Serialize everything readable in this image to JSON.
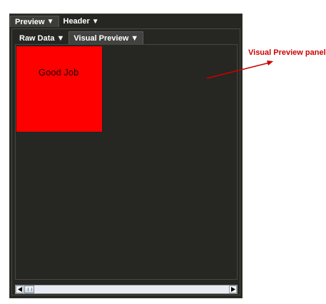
{
  "outer_tabs": [
    {
      "label": "Preview",
      "chevron": "▼",
      "selected": true
    },
    {
      "label": "Header",
      "chevron": "▼",
      "selected": false
    }
  ],
  "inner_tabs": [
    {
      "label": "Raw Data",
      "chevron": "▼",
      "selected": false
    },
    {
      "label": "Visual Preview",
      "chevron": "▼",
      "selected": true
    }
  ],
  "preview": {
    "box_text": "Good Job",
    "box_color": "#ff0000"
  },
  "annotation": {
    "text": "Visual Preview panel",
    "color": "#cc0000"
  },
  "icons": {
    "scroll_left": "scroll-left-arrow-icon",
    "scroll_right": "scroll-right-arrow-icon",
    "chevron": "chevron-down-icon"
  }
}
